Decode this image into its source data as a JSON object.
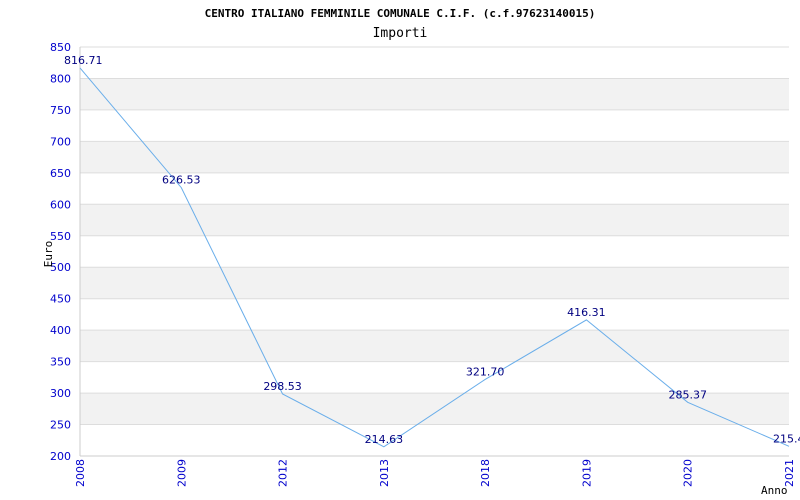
{
  "chart_data": {
    "type": "line",
    "title": "CENTRO ITALIANO FEMMINILE COMUNALE C.I.F. (c.f.97623140015)",
    "subtitle": "Importi",
    "xlabel": "Anno",
    "ylabel": "Euro",
    "categories": [
      "2008",
      "2009",
      "2012",
      "2013",
      "2018",
      "2019",
      "2020",
      "2021"
    ],
    "values": [
      816.71,
      626.53,
      298.53,
      214.63,
      321.7,
      416.31,
      285.37,
      215.4
    ],
    "data_labels": [
      "816.71",
      "626.53",
      "298.53",
      "214.63",
      "321.70",
      "416.31",
      "285.37",
      "215.4"
    ],
    "ylim": [
      200,
      850
    ],
    "yticks": [
      200,
      250,
      300,
      350,
      400,
      450,
      500,
      550,
      600,
      650,
      700,
      750,
      800,
      850
    ],
    "grid": true,
    "line_color": "#6aaeea",
    "tick_color": "#0000cc",
    "label_color": "#000080",
    "band_color": "#f2f2f2"
  }
}
